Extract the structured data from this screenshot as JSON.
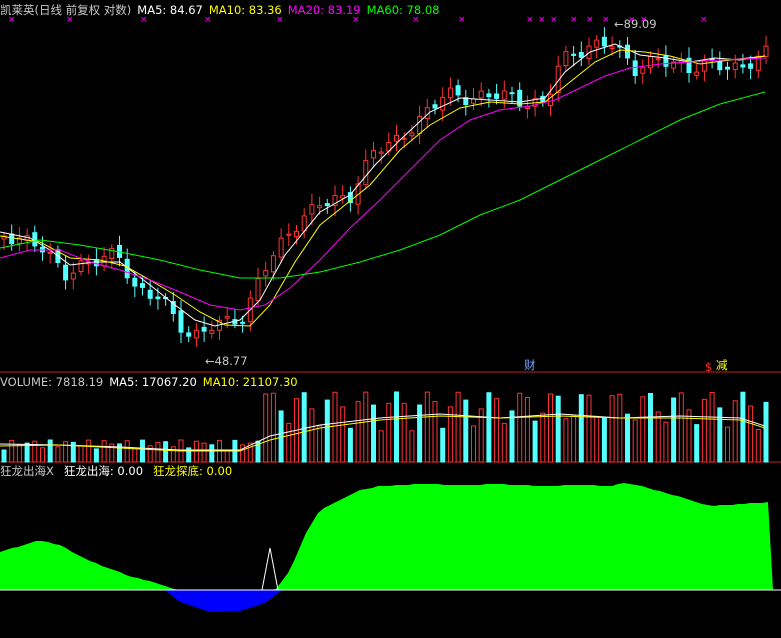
{
  "header": {
    "title": "凯莱英(日线 前复权 对数)",
    "ma5": "MA5: 84.67",
    "ma10": "MA10: 83.36",
    "ma20": "MA20: 83.19",
    "ma60": "MA60: 78.08"
  },
  "volume_header": {
    "volume": "VOLUME: 7818.19",
    "ma5": "MA5: 17067.20",
    "ma10": "MA10: 21107.30"
  },
  "indicator_header": {
    "name": "狂龙出海X",
    "line1": "狂龙出海: 0.00",
    "line2": "狂龙探底: 0.00"
  },
  "price_annotations": {
    "high": "89.09",
    "low": "48.77",
    "cai": "财",
    "dollar": "$",
    "jian": "减"
  },
  "colors": {
    "up": "#ff3232",
    "down": "#54ffff",
    "ma5": "#ffffff",
    "ma10": "#ffff00",
    "ma20": "#ff00ff",
    "ma60": "#00ff00",
    "divider": "#c81e1e",
    "indicator_pos": "#00ff00",
    "indicator_neg": "#0000ff",
    "cross": "#ff00ff"
  },
  "chart_data": {
    "type": "candlestick",
    "price_high": 89.09,
    "price_low": 48.77,
    "ma_latest": {
      "MA5": 84.67,
      "MA10": 83.36,
      "MA20": 83.19,
      "MA60": 78.08
    },
    "volume_latest": {
      "VOLUME": 7818.19,
      "MA5": 17067.2,
      "MA10": 21107.3
    },
    "indicator_latest": {
      "狂龙出海": 0.0,
      "狂龙探底": 0.0
    }
  }
}
